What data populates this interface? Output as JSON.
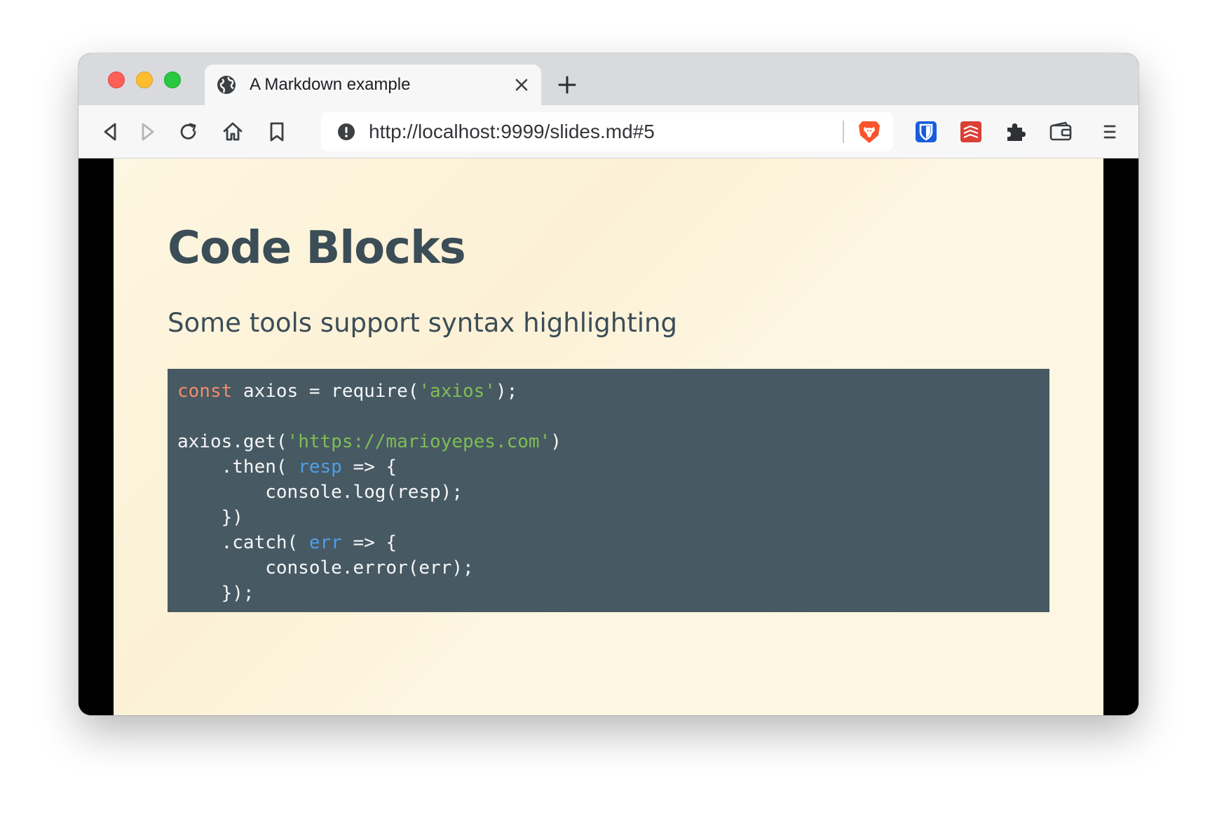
{
  "browser": {
    "tab": {
      "title": "A Markdown example",
      "icon": "globe-icon"
    },
    "new_tab_icon": "plus-icon",
    "toolbar": {
      "back_icon": "back-arrow-icon",
      "forward_icon": "forward-arrow-icon",
      "reload_icon": "reload-icon",
      "home_icon": "home-icon",
      "bookmark_icon": "bookmark-icon"
    },
    "address_bar": {
      "url": "http://localhost:9999/slides.md#5",
      "security_icon": "info-icon",
      "shield_icon": "brave-lion-icon"
    },
    "extensions": [
      "bitwarden-icon",
      "todoist-icon",
      "puzzle-icon",
      "wallet-icon",
      "menu-icon"
    ],
    "colors": {
      "tabstrip_bg": "#d8dade",
      "toolbar_bg": "#f7f7f8",
      "close_red": "#fe5f57",
      "minimize_yellow": "#febc2e",
      "zoom_green": "#28c840"
    }
  },
  "slide": {
    "title": "Code Blocks",
    "subtitle": "Some tools support syntax highlighting",
    "code": {
      "language": "javascript",
      "lines": [
        [
          {
            "t": "kw",
            "v": "const"
          },
          {
            "t": "plain",
            "v": " axios = require("
          },
          {
            "t": "str",
            "v": "'axios'"
          },
          {
            "t": "plain",
            "v": ");"
          }
        ],
        [],
        [
          {
            "t": "plain",
            "v": "axios.get("
          },
          {
            "t": "str",
            "v": "'https://marioyepes.com'"
          },
          {
            "t": "plain",
            "v": ")"
          }
        ],
        [
          {
            "t": "plain",
            "v": "    .then( "
          },
          {
            "t": "param",
            "v": "resp"
          },
          {
            "t": "plain",
            "v": " => {"
          }
        ],
        [
          {
            "t": "plain",
            "v": "        console.log(resp);"
          }
        ],
        [
          {
            "t": "plain",
            "v": "    })"
          }
        ],
        [
          {
            "t": "plain",
            "v": "    .catch( "
          },
          {
            "t": "param",
            "v": "err"
          },
          {
            "t": "plain",
            "v": " => {"
          }
        ],
        [
          {
            "t": "plain",
            "v": "        console.error(err);"
          }
        ],
        [
          {
            "t": "plain",
            "v": "    });"
          }
        ]
      ]
    },
    "colors": {
      "background": "#fdf6e0",
      "heading": "#3b4d57",
      "code_bg": "#475963",
      "keyword": "#f08d6b",
      "string": "#7dbf55",
      "parameter": "#4e9fe8",
      "code_text": "#f6f7f8"
    }
  }
}
